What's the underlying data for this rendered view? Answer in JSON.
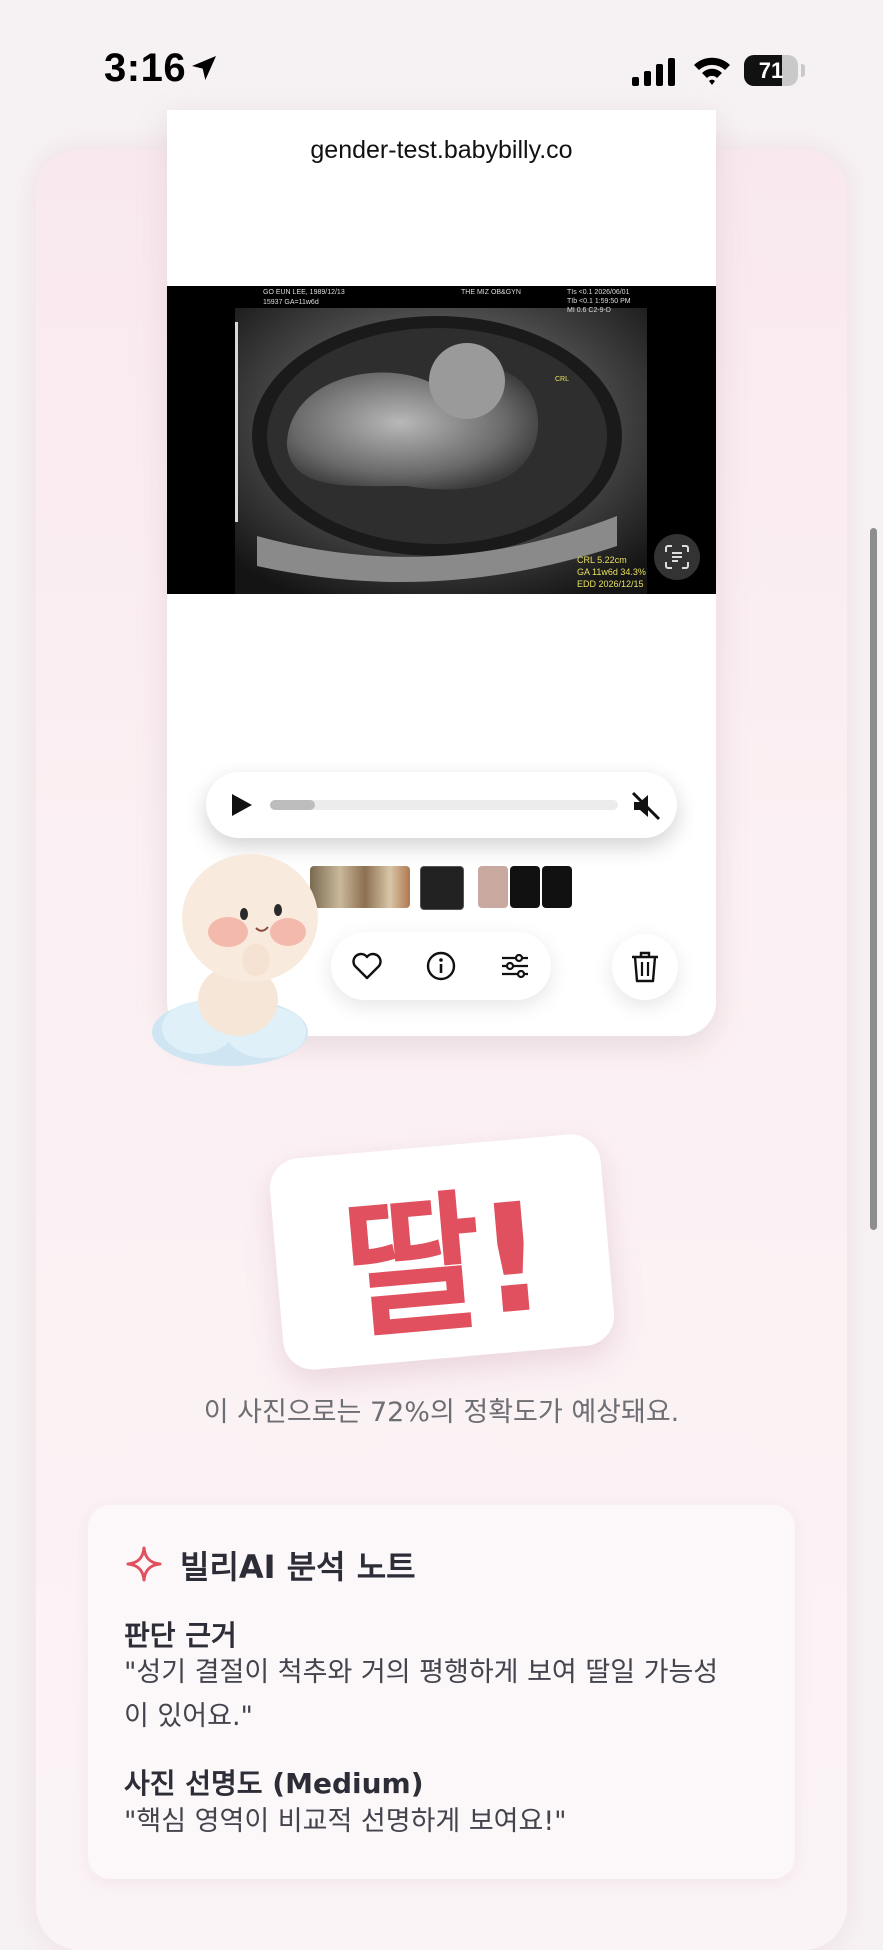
{
  "status_bar": {
    "time": "3:16",
    "battery": "71",
    "battery_level": 0.71
  },
  "browser": {
    "url": "gender-test.babybilly.co"
  },
  "ultrasound": {
    "patient": "GO EUN LEE, 1989/12/13",
    "id": "15937  GA=11w6d",
    "clinic": "THE MIZ OB&GYN",
    "params": "TIs <0.1  2026/06/01",
    "params2": "TIb <0.1  1:59:50 PM",
    "params3": "MI 0.6   C2-9-D",
    "crl_label": "CRL",
    "crl": "CRL      5.22cm",
    "ga": "GA 11w6d 34.3%",
    "edd": "EDD 2026/12/15"
  },
  "player": {
    "progress": 0.13
  },
  "result": {
    "label": "딸!",
    "accuracy_text": "이 사진으로는 72%의 정확도가 예상돼요."
  },
  "note": {
    "title": "빌리AI 분석 노트",
    "reason_heading": "판단 근거",
    "reason_line1": "\"성기 결절이 척추와 거의 평행하게 보여 딸일 가능성",
    "reason_line2": "이 있어요.\"",
    "clarity_heading": "사진 선명도 (Medium)",
    "clarity_text": "\"핵심 영역이 비교적 선명하게 보여요!\""
  },
  "colors": {
    "accent": "#e0505f",
    "background": "#f6f1f3"
  }
}
